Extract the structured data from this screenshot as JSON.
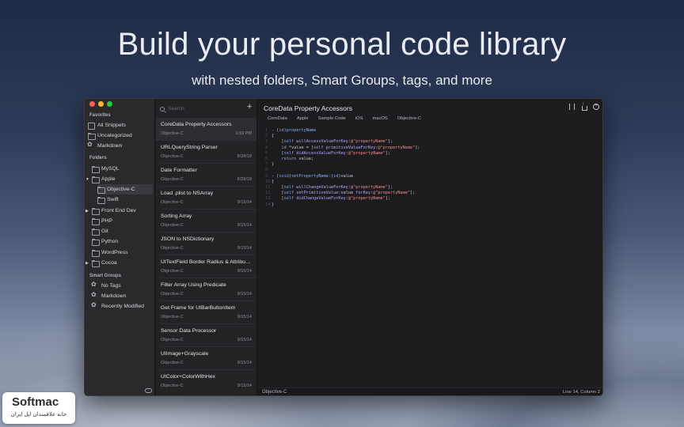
{
  "hero": {
    "title": "Build your personal code library",
    "subtitle": "with nested folders, Smart Groups, tags, and more"
  },
  "colors": {
    "close": "#ff5f57",
    "minimize": "#febc2e",
    "zoom": "#28c840"
  },
  "sidebar": {
    "favorites_header": "Favorites",
    "favorites": [
      {
        "label": "All Snippets",
        "icon": "stack-icon"
      },
      {
        "label": "Uncategorized",
        "icon": "folder-icon"
      },
      {
        "label": "Markdown",
        "icon": "gear-icon"
      }
    ],
    "folders_header": "Folders",
    "folders": [
      {
        "label": "MySQL"
      },
      {
        "label": "Apple",
        "expanded": true
      },
      {
        "label": "Objective-C",
        "selected": true
      },
      {
        "label": "Swift"
      },
      {
        "label": "Front End Dev",
        "collapsed": true
      },
      {
        "label": "PHP"
      },
      {
        "label": "Git"
      },
      {
        "label": "Python"
      },
      {
        "label": "WordPress"
      },
      {
        "label": "Cocoa",
        "collapsed": true
      }
    ],
    "smart_header": "Smart Groups",
    "smart_groups": [
      {
        "label": "No Tags"
      },
      {
        "label": "Markdown"
      },
      {
        "label": "Recently Modified"
      }
    ]
  },
  "list": {
    "search_placeholder": "Search",
    "add_label": "+",
    "snippets": [
      {
        "title": "CoreData Property Accessors",
        "lang": "Objective-C",
        "date": "9:59 PM",
        "selected": true
      },
      {
        "title": "URLQueryString Parser",
        "lang": "Objective-C",
        "date": "8/28/18"
      },
      {
        "title": "Date Formatter",
        "lang": "Objective-C",
        "date": "8/28/18"
      },
      {
        "title": "Load .plist to NSArray",
        "lang": "Objective-C",
        "date": "9/15/14"
      },
      {
        "title": "Sorting Array",
        "lang": "Objective-C",
        "date": "9/15/14"
      },
      {
        "title": "JSON to NSDictionary",
        "lang": "Objective-C",
        "date": "9/15/14"
      },
      {
        "title": "UITextField Border Radius & Attribu…",
        "lang": "Objective-C",
        "date": "9/15/14"
      },
      {
        "title": "Filter Array Using Predicate",
        "lang": "Objective-C",
        "date": "9/15/14"
      },
      {
        "title": "Get Frame for UIBarButtonItem",
        "lang": "Objective-C",
        "date": "9/15/14"
      },
      {
        "title": "Sensor Data Processor",
        "lang": "Objective-C",
        "date": "9/15/14"
      },
      {
        "title": "UIImage+Grayscale",
        "lang": "Objective-C",
        "date": "9/15/14"
      },
      {
        "title": "UIColor+ColorWithHex",
        "lang": "Objective-C",
        "date": "9/15/14"
      }
    ]
  },
  "editor": {
    "title": "CoreData Property Accessors",
    "tags": [
      "CoreData",
      "Apple",
      "Sample Code",
      "iOS",
      "macOS",
      "Objective-C"
    ],
    "code_lines": [
      "- (id)propertyName",
      "{",
      "    [self willAccessValueForKey:@\"propertyName\"];",
      "    id *value = [self primitiveValueForKey:@\"propertyName\"];",
      "    [self didAccessValueForKey:@\"propertyName\"];",
      "    return value;",
      "}",
      "",
      "- (void)setPropertyName:(id)value",
      "{",
      "    [self willChangeValueForKey:@\"propertyName\"];",
      "    [self setPrimitiveValue:value forKey:@\"propertyName\"];",
      "    [self didChangeValueForKey:@\"propertyName\"];",
      "}"
    ],
    "status_language": "Objective-C",
    "status_position": "Line 14, Column 2"
  },
  "watermark": {
    "name": "Softmac",
    "tagline": "خانه علاقمندان اپل ایران"
  }
}
